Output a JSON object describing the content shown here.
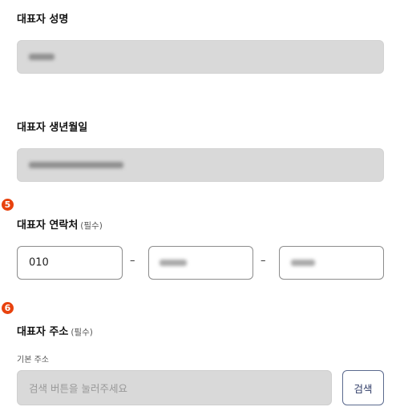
{
  "rep_name": {
    "label": "대표자 성명"
  },
  "rep_birth": {
    "label": "대표자 생년월일"
  },
  "rep_contact": {
    "badge": "5",
    "label": "대표자 연락처",
    "required": "(필수)",
    "first_value": "010",
    "separator": "–"
  },
  "rep_address": {
    "badge": "6",
    "label": "대표자 주소",
    "required": "(필수)",
    "sub_label": "기본 주소",
    "placeholder": "검색 버튼을 눌러주세요",
    "search_button": "검색"
  },
  "colors": {
    "badge": "#e8420e",
    "disabled_field": "#d9d9d9",
    "button_text": "#2d3a66"
  }
}
